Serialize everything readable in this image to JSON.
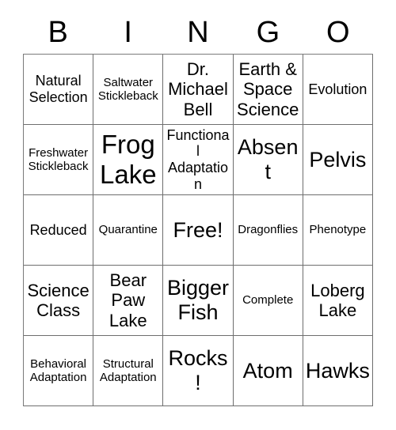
{
  "card": {
    "title": "Bingo Card",
    "header_letters": [
      "B",
      "I",
      "N",
      "G",
      "O"
    ],
    "grid_size": "5x5",
    "colors": {
      "background": "#ffffff",
      "text": "#000000",
      "grid_line": "#6e6e6e"
    },
    "rows": [
      [
        {
          "text": "Natural Selection",
          "size": "md",
          "free": false
        },
        {
          "text": "Saltwater Stickleback",
          "size": "sm",
          "free": false
        },
        {
          "text": "Dr. Michael Bell",
          "size": "lg",
          "free": false
        },
        {
          "text": "Earth & Space Science",
          "size": "lg",
          "free": false
        },
        {
          "text": "Evolution",
          "size": "md",
          "free": false
        }
      ],
      [
        {
          "text": "Freshwater Stickleback",
          "size": "sm",
          "free": false
        },
        {
          "text": "Frog Lake",
          "size": "xxl",
          "free": false
        },
        {
          "text": "Functional Adaptation",
          "size": "md",
          "free": false
        },
        {
          "text": "Absent",
          "size": "xl",
          "free": false
        },
        {
          "text": "Pelvis",
          "size": "xl",
          "free": false
        }
      ],
      [
        {
          "text": "Reduced",
          "size": "md",
          "free": false
        },
        {
          "text": "Quarantine",
          "size": "sm",
          "free": false
        },
        {
          "text": "Free!",
          "size": "xl",
          "free": true
        },
        {
          "text": "Dragonflies",
          "size": "sm",
          "free": false
        },
        {
          "text": "Phenotype",
          "size": "sm",
          "free": false
        }
      ],
      [
        {
          "text": "Science Class",
          "size": "lg",
          "free": false
        },
        {
          "text": "Bear Paw Lake",
          "size": "lg",
          "free": false
        },
        {
          "text": "Bigger Fish",
          "size": "xl",
          "free": false
        },
        {
          "text": "Complete",
          "size": "sm",
          "free": false
        },
        {
          "text": "Loberg Lake",
          "size": "lg",
          "free": false
        }
      ],
      [
        {
          "text": "Behavioral Adaptation",
          "size": "sm",
          "free": false
        },
        {
          "text": "Structural Adaptation",
          "size": "sm",
          "free": false
        },
        {
          "text": "Rocks!",
          "size": "xl",
          "free": false
        },
        {
          "text": "Atom",
          "size": "xl",
          "free": false
        },
        {
          "text": "Hawks",
          "size": "xl",
          "free": false
        }
      ]
    ]
  }
}
